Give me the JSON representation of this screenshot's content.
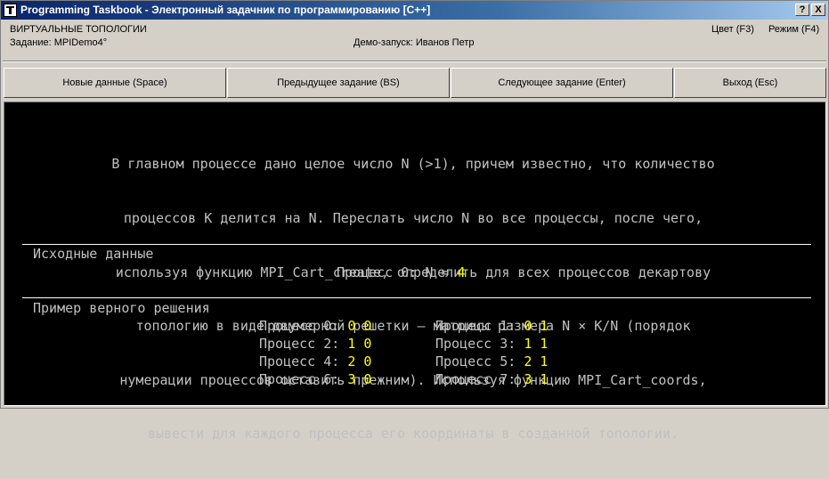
{
  "window": {
    "title": "Programming Taskbook - Электронный задачник по программированию [C++]",
    "help_button": "?",
    "close_button": "X"
  },
  "info": {
    "group": "ВИРТУАЛЬНЫЕ ТОПОЛОГИИ",
    "task": "Задание: MPIDemo4°",
    "demo": "Демо-запуск: Иванов Петр",
    "color": "Цвет (F3)",
    "mode": "Режим (F4)"
  },
  "toolbar": {
    "new_data": "Новые данные (Space)",
    "prev_task": "Предыдущее задание (BS)",
    "next_task": "Следующее задание (Enter)",
    "exit": "Выход (Esc)"
  },
  "task_text": [
    "В главном процессе дано целое число N (>1), причем известно, что количество",
    "процессов K делится на N. Переслать число N во все процессы, после чего,",
    "используя функцию MPI_Cart_create, определить для всех процессов декартову",
    "топологию в виде двумерной решетки — матрицы размера N × K/N (порядок",
    "нумерации процессов оставить прежним). Используя функцию MPI_Cart_coords,",
    "вывести для каждого процесса его координаты в созданной топологии."
  ],
  "input": {
    "header": "Исходные данные",
    "label": "Процесс 0: N = ",
    "value": "4"
  },
  "example": {
    "header": "Пример верного решения",
    "rows": [
      [
        {
          "label": "Процесс 0: ",
          "value": "0 0"
        },
        {
          "label": "Процесс 1: ",
          "value": "0 1"
        }
      ],
      [
        {
          "label": "Процесс 2: ",
          "value": "1 0"
        },
        {
          "label": "Процесс 3: ",
          "value": "1 1"
        }
      ],
      [
        {
          "label": "Процесс 4: ",
          "value": "2 0"
        },
        {
          "label": "Процесс 5: ",
          "value": "2 1"
        }
      ],
      [
        {
          "label": "Процесс 6: ",
          "value": "3 0"
        },
        {
          "label": "Процесс 7: ",
          "value": "3 1"
        }
      ]
    ]
  },
  "colors": {
    "screen_bg": "#000000",
    "text": "#c0c0c0",
    "values": "#ffff00",
    "titlebar": "#0a246a"
  }
}
